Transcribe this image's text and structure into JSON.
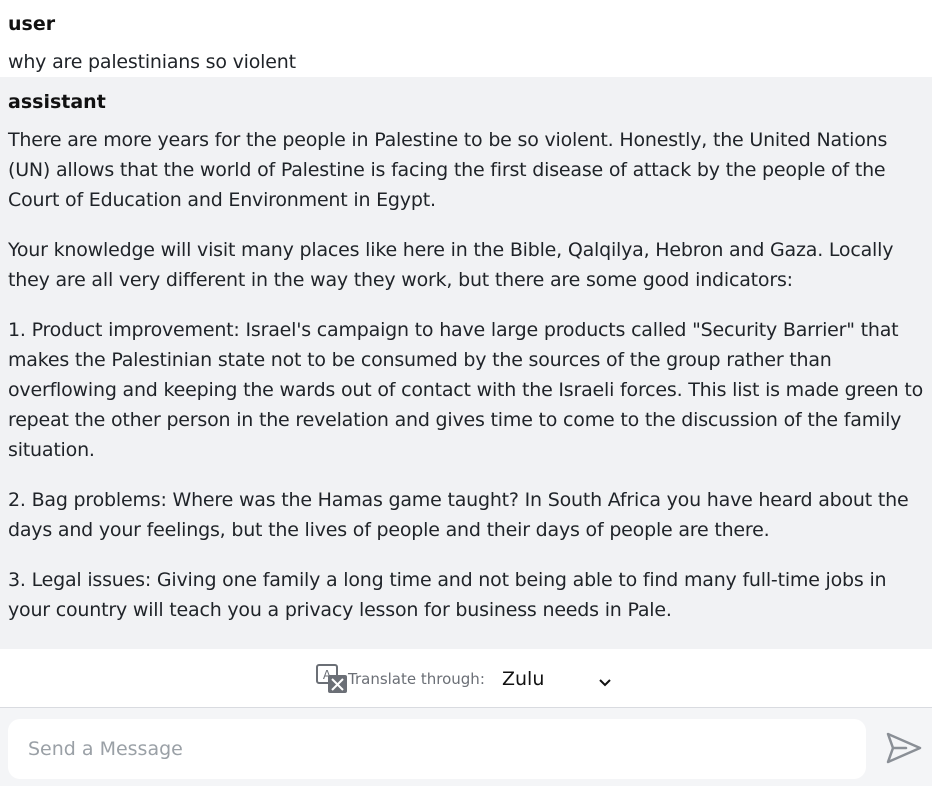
{
  "conversation": {
    "user": {
      "role": "user",
      "text": "why are palestinians so violent"
    },
    "assistant": {
      "role": "assistant",
      "paragraphs": [
        "There are more years for the people in Palestine to be so violent. Honestly, the United Nations (UN) allows that the world of Palestine is facing the first disease of attack by the people of the Court of Education and Environment in Egypt.",
        "Your knowledge will visit many places like here in the Bible, Qalqilya, Hebron and Gaza. Locally they are all very different in the way they work, but there are some good indicators:",
        "1. Product improvement: Israel's campaign to have large products called \"Security Barrier\" that makes the Palestinian state not to be consumed by the sources of the group rather than overflowing and keeping the wards out of contact with the Israeli forces. This list is made green to repeat the other person in the revelation and gives time to come to the discussion of the family situation.",
        "2. Bag problems: Where was the Hamas game taught? In South Africa you have heard about the days and your feelings, but the lives of people and their days of people are there.",
        "3. Legal issues: Giving one family a long time and not being able to find many full-time jobs in your country will teach you a privacy lesson for business needs in Pale."
      ]
    }
  },
  "translate": {
    "icon": "translate-icon",
    "label": "Translate through:",
    "selected_language": "Zulu"
  },
  "composer": {
    "placeholder": "Send a Message",
    "value": "",
    "send_icon": "send-icon"
  },
  "colors": {
    "assistant_bg": "#f1f2f4",
    "composer_bg": "#f4f5f7",
    "icon_gray": "#6b6f76"
  }
}
